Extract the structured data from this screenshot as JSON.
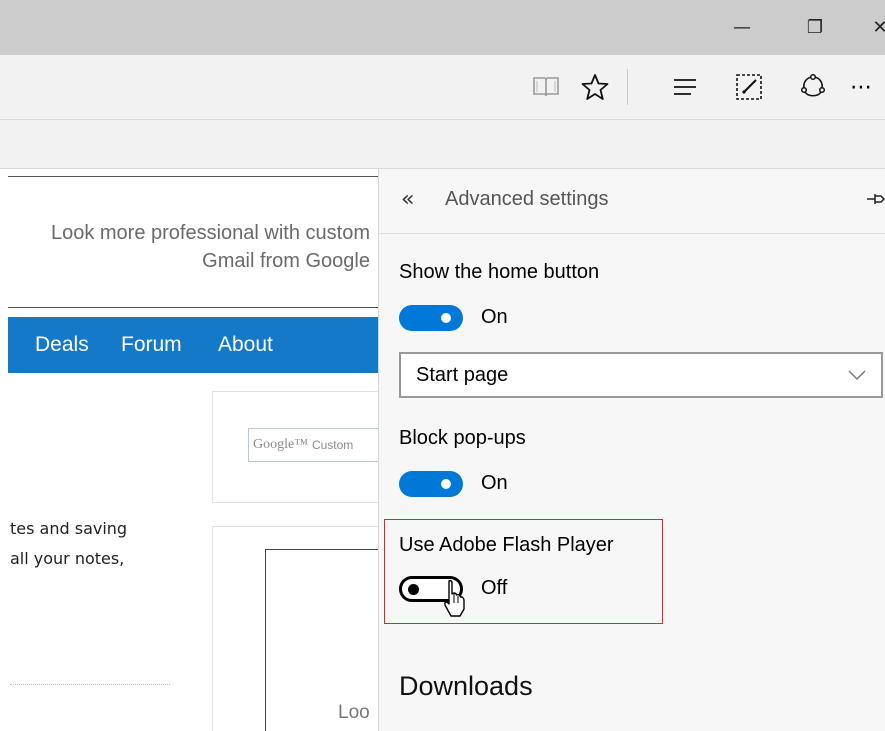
{
  "window": {
    "minimize_glyph": "—",
    "restore_glyph": "❐",
    "close_glyph": "✕"
  },
  "toolbar": {
    "icons": [
      "reading-view-icon",
      "favorite-star-icon",
      "hub-icon",
      "web-note-icon",
      "share-icon",
      "more-icon"
    ],
    "more_glyph": "⋯"
  },
  "webpage": {
    "ad_text": "Look more professional with custom Gmail from Google",
    "nav": {
      "items": [
        "Deals",
        "Forum",
        "About"
      ],
      "background": "#1479c9"
    },
    "search": {
      "logo_text": "Google™",
      "custom_text": "Custom"
    },
    "body_lines": [
      "tes and saving",
      "all your notes,"
    ],
    "box_text": "Loo"
  },
  "settings": {
    "back_glyph": "«",
    "title": "Advanced settings",
    "home_button": {
      "label": "Show the home button",
      "state": "On"
    },
    "home_page_select": {
      "value": "Start page"
    },
    "popups": {
      "label": "Block pop-ups",
      "state": "On"
    },
    "flash": {
      "label": "Use Adobe Flash Player",
      "state": "Off"
    },
    "downloads_heading": "Downloads",
    "accent_color": "#0078d7",
    "highlight_color": "#e8222a"
  }
}
